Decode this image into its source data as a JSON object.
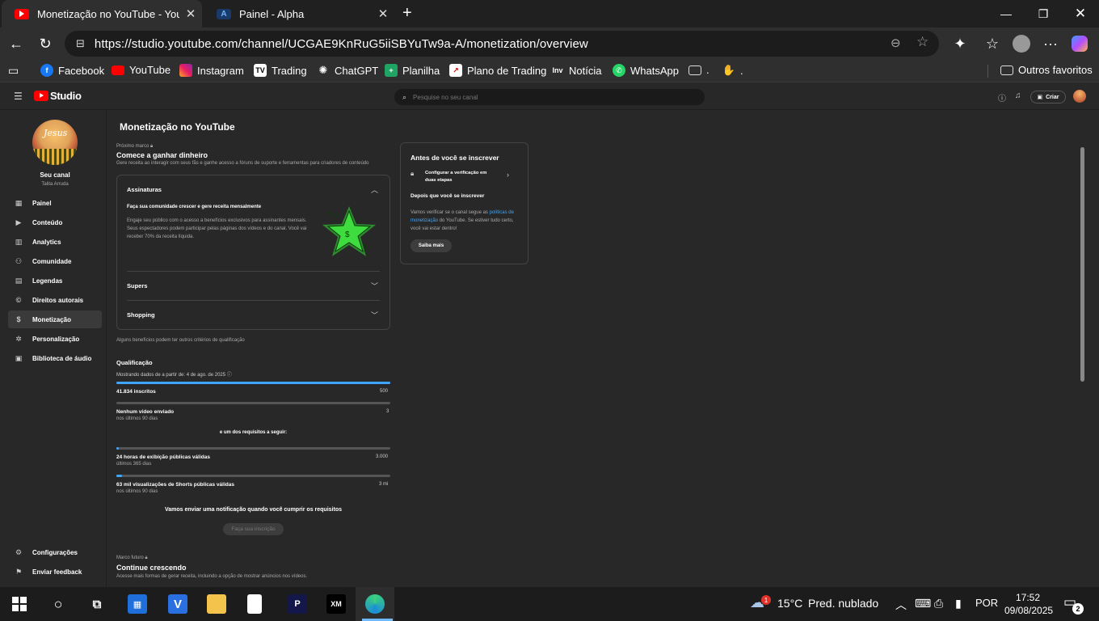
{
  "browser": {
    "tabs": [
      {
        "title": "Monetização no YouTube - YouTube Studio",
        "active": true
      },
      {
        "title": "Painel - Alpha",
        "active": false
      }
    ],
    "new_tab_icon": "plus-icon",
    "url": "https://studio.youtube.com/channel/UCGAE9KnRuG5iiSBYuTw9a-A/monetization/overview",
    "bookmarks": [
      "Facebook",
      "YouTube",
      "Instagram",
      "Trading",
      "ChatGPT",
      "Planilha",
      "Plano de Trading",
      "Notícia",
      "WhatsApp",
      ".",
      "."
    ],
    "other_favorites": "Outros favoritos"
  },
  "studio": {
    "logo_text": "Studio",
    "search_placeholder": "Pesquise no seu canal",
    "create_label": "Criar",
    "channel_name": "Seu canal",
    "channel_handle": "Talita Arruda",
    "nav": [
      "Painel",
      "Conteúdo",
      "Analytics",
      "Comunidade",
      "Legendas",
      "Direitos autorais",
      "Monetização",
      "Personalização",
      "Biblioteca de áudio"
    ],
    "nav_bottom": [
      "Configurações",
      "Enviar feedback"
    ],
    "page_title": "Monetização no YouTube",
    "next_milestone": "Próximo marco",
    "milestone_title": "Comece a ganhar dinheiro",
    "milestone_desc": "Gere receita ao interagir com seus fãs e ganhe acesso a fóruns de suporte e ferramentas para criadores de conteúdo",
    "accordion": {
      "subscriptions": "Assinaturas",
      "sub_heading": "Faça sua comunidade crescer e gere receita mensalmente",
      "sub_body": "Engaje seu público com o acesso a benefícios exclusivos para assinantes mensais. Seus espectadores podem participar pelas páginas dos vídeos e do canal. Você vai receber 70% da receita líquida.",
      "supers": "Supers",
      "shopping": "Shopping"
    },
    "criteria_note": "Alguns benefícios podem ter outros critérios de qualificação",
    "qualification": {
      "title": "Qualificação",
      "showing": "Mostrando dados de a partir de: 4 de ago. de 2025",
      "subs_label": "41.834 inscritos",
      "subs_target": "500",
      "subs_progress": 1.0,
      "videos_label": "Nenhum vídeo enviado",
      "videos_sub": "nos últimos 90 dias",
      "videos_target": "3",
      "videos_progress": 0.0,
      "one_of": "e um dos requisitos a seguir:",
      "watch_label": "24 horas de exibição públicas válidas",
      "watch_sub": "últimos 365 dias",
      "watch_target": "3.000",
      "watch_progress": 0.01,
      "shorts_label": "63 mil visualizações de Shorts públicas válidas",
      "shorts_sub": "nos últimos 90 dias",
      "shorts_target": "3 mi",
      "shorts_progress": 0.02,
      "notify": "Vamos enviar uma notificação quando você cumprir os requisitos",
      "apply_button": "Faça sua inscrição"
    },
    "future": {
      "label": "Marco futuro",
      "title": "Continue crescendo",
      "desc": "Acesse mais formas de gerar receita, incluindo a opção de mostrar anúncios nos vídeos."
    },
    "before": {
      "title": "Antes de você se inscrever",
      "step": "Configurar a verificação em duas etapas",
      "after_title": "Depois que você se inscrever",
      "after_pre": "Vamos verificar se o canal segue as ",
      "after_link": "políticas de monetização",
      "after_post": " do YouTube. Se estiver tudo certo, você vai estar dentro!",
      "learn_more": "Saiba mais"
    }
  },
  "taskbar": {
    "weather_temp": "15°C",
    "weather_desc": "Pred. nublado",
    "weather_badge": "1",
    "lang": "POR",
    "time": "17:52",
    "date": "09/08/2025",
    "notif_count": "2"
  }
}
